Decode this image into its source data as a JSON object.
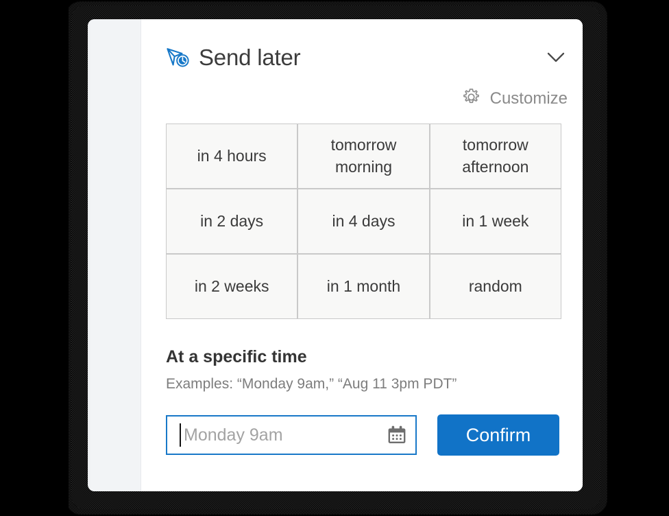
{
  "panel": {
    "title": "Send later",
    "title_icon": "send-later-icon",
    "collapse_icon": "chevron-down-icon",
    "accent_color": "#1173c7"
  },
  "customize": {
    "label": "Customize",
    "icon": "gear-icon"
  },
  "quick_options": [
    "in 4 hours",
    "tomorrow morning",
    "tomorrow afternoon",
    "in 2 days",
    "in 4 days",
    "in 1 week",
    "in 2 weeks",
    "in 1 month",
    "random"
  ],
  "specific_time": {
    "heading": "At a specific time",
    "examples": "Examples: “Monday 9am,” “Aug 11 3pm PDT”",
    "input_value": "",
    "input_placeholder": "Monday 9am",
    "calendar_icon": "calendar-icon",
    "confirm_label": "Confirm"
  }
}
